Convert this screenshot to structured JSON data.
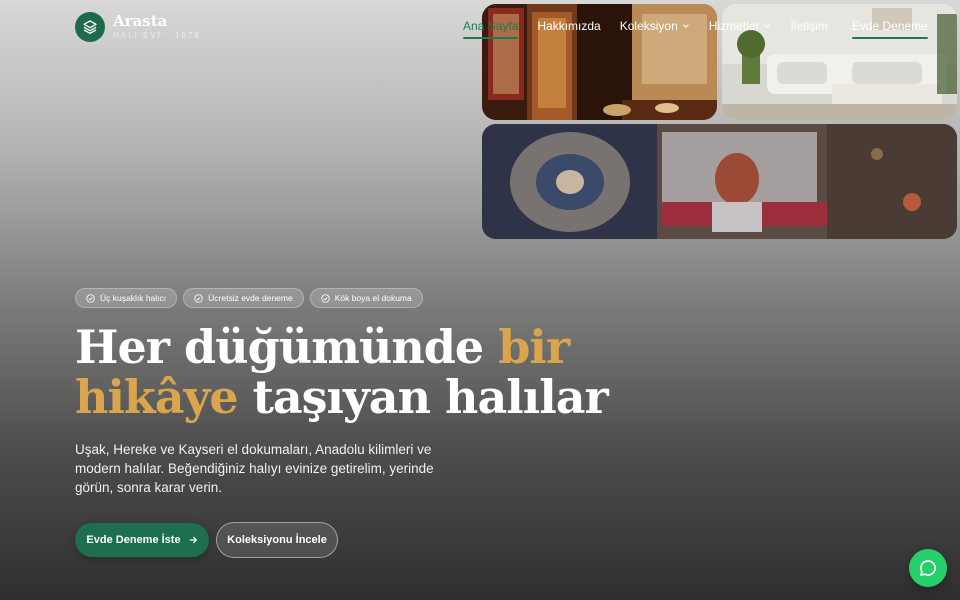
{
  "brand": {
    "name": "Arasta",
    "tagline": "HALI EVİ · 1978",
    "logo_icon": "layers-icon",
    "accent_color": "#1e6f4d"
  },
  "nav": {
    "items": [
      {
        "label": "Ana Sayfa",
        "active": true
      },
      {
        "label": "Hakkımızda"
      },
      {
        "label": "Koleksiyon",
        "dropdown": true
      },
      {
        "label": "Hizmetler",
        "dropdown": true
      },
      {
        "label": "İletişim"
      }
    ],
    "cta": "Evde Deneme"
  },
  "chips": [
    {
      "icon": "check-circle-icon",
      "label": "Üç kuşaklık halıcı"
    },
    {
      "icon": "check-circle-icon",
      "label": "Ücretsiz evde deneme"
    },
    {
      "icon": "check-circle-icon",
      "label": "Kök boya el dokuma"
    }
  ],
  "hero": {
    "headline_part1": "Her düğümünde ",
    "headline_highlight1": "bir",
    "headline_highlight2": "hikâye",
    "headline_part2": " taşıyan halılar",
    "highlight_color": "#dba54d",
    "lead": "Uşak, Hereke ve Kayseri el dokumaları, Anadolu kilimleri ve modern halılar. Beğendiğiniz halıyı evinize getirelim, yerinde görün, sonra karar verin.",
    "primary_button": "Evde Deneme İste",
    "primary_icon": "arrow-right-icon",
    "secondary_button": "Koleksiyonu İncele"
  },
  "chat_button": {
    "icon": "chat-bubble-icon",
    "color": "#25cf6a"
  }
}
